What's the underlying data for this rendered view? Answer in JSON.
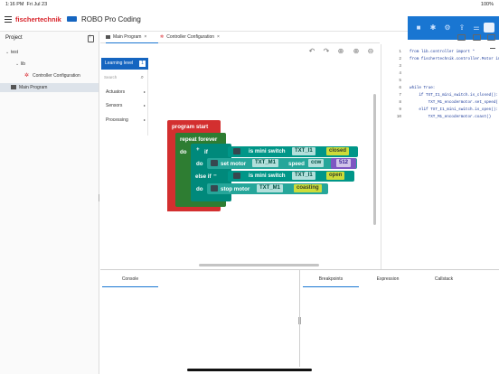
{
  "status_bar": {
    "time": "1:16 PM",
    "date": "Fri Jul 23",
    "battery": "100%"
  },
  "app": {
    "brand": "fischertechnik",
    "title": "ROBO Pro Coding"
  },
  "toolbar_icons": [
    "stop-icon",
    "cable-icon",
    "settings-icon",
    "export-icon",
    "code-view-icon",
    "user-icon"
  ],
  "project": {
    "title": "Project",
    "tree": [
      {
        "label": "test",
        "level": 0
      },
      {
        "label": "lib",
        "level": 1
      },
      {
        "label": "Controller Configuration",
        "level": 2
      },
      {
        "label": "Main Program",
        "level": 1,
        "selected": true
      }
    ]
  },
  "tabs": [
    {
      "label": "Main Program",
      "active": true
    },
    {
      "label": "Controller Configuration",
      "active": false
    }
  ],
  "toolbox": {
    "level_label": "Learning level",
    "level_value": "1",
    "search_placeholder": "Search",
    "categories": [
      "Actuators",
      "Sensors",
      "Processing"
    ]
  },
  "blocks": {
    "program_start": "program start",
    "repeat_forever": "repeat forever",
    "do": "do",
    "if": "if",
    "else_if": "else if",
    "plus": "+",
    "minus": "−",
    "is_mini_switch": "is mini switch",
    "switch_1": "TXT_I1",
    "state_closed": "closed",
    "do_1": "do",
    "set_motor": "set motor",
    "motor_1": "TXT_M1",
    "speed": "speed",
    "direction": "ccw",
    "speed_value": "512",
    "is_mini_switch_2": "is mini switch",
    "switch_2": "TXT_I1",
    "state_open": "open",
    "do_2": "do",
    "stop_motor": "stop motor",
    "motor_2": "TXT_M1",
    "stop_mode": "coasting"
  },
  "code_lines": [
    "from lib.controller import *",
    "from fischertechnik.controller.Motor imp",
    "",
    "",
    "",
    "while True:",
    "    if TXT_I1_mini_switch.is_closed():",
    "        TXT_M1_encodermotor.set_speed(",
    "    elif TXT_I1_mini_switch.is_open():",
    "        TXT_M1_encodermotor.coast()",
    ""
  ],
  "bottom_tabs": [
    "Console",
    "Breakpoints",
    "Expression",
    "Callstack"
  ],
  "colors": {
    "accent": "#1976d2",
    "brand_red": "#d8232a",
    "block_red": "#d32f2f",
    "block_green": "#2e7d32",
    "block_teal": "#00897b",
    "block_dark": "#37474f",
    "field_yellow": "#cddc39",
    "field_purple": "#7e57c2"
  }
}
